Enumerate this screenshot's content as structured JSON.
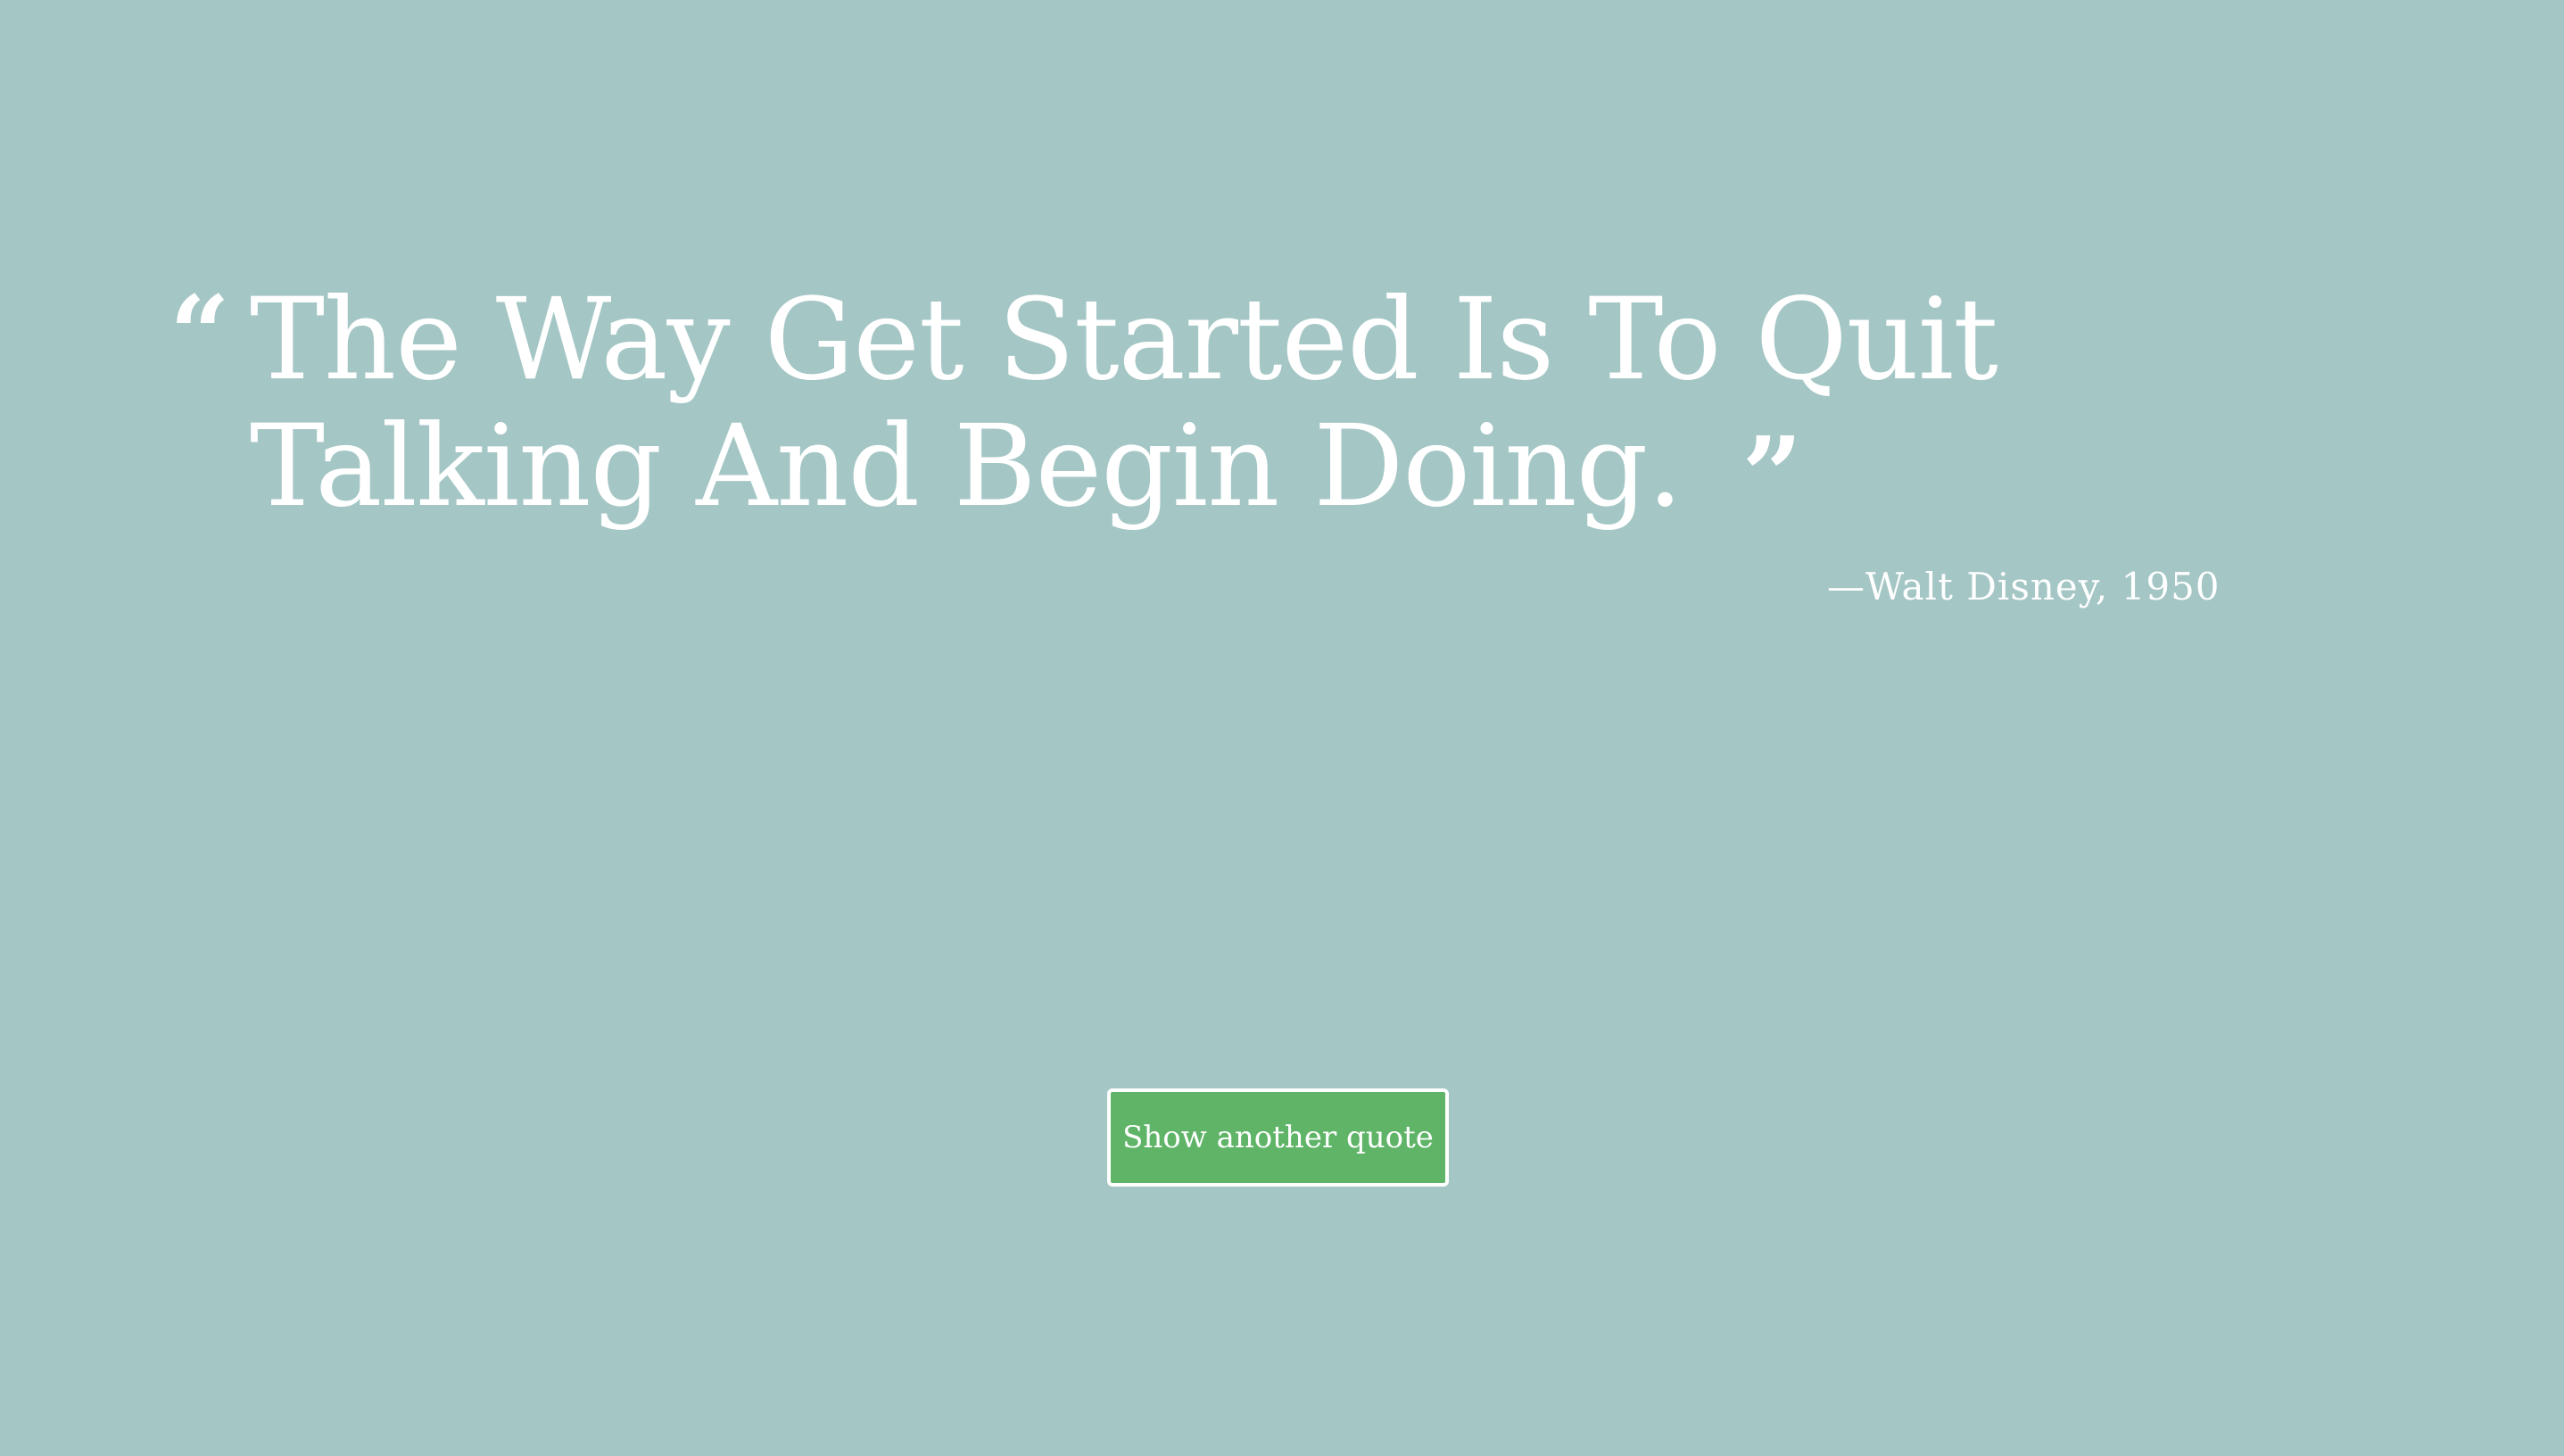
{
  "quote": {
    "text": "The Way Get Started Is To Quit Talking And Begin Doing.",
    "open_mark": "“",
    "close_mark": "”",
    "author": "—Walt Disney, 1950"
  },
  "actions": {
    "new_quote_label": "Show another quote"
  },
  "colors": {
    "background": "#a4c6c5",
    "button": "#5fb468",
    "text": "#ffffff"
  },
  "icons": {
    "open_quote": "open-quote-icon",
    "close_quote": "close-quote-icon"
  }
}
